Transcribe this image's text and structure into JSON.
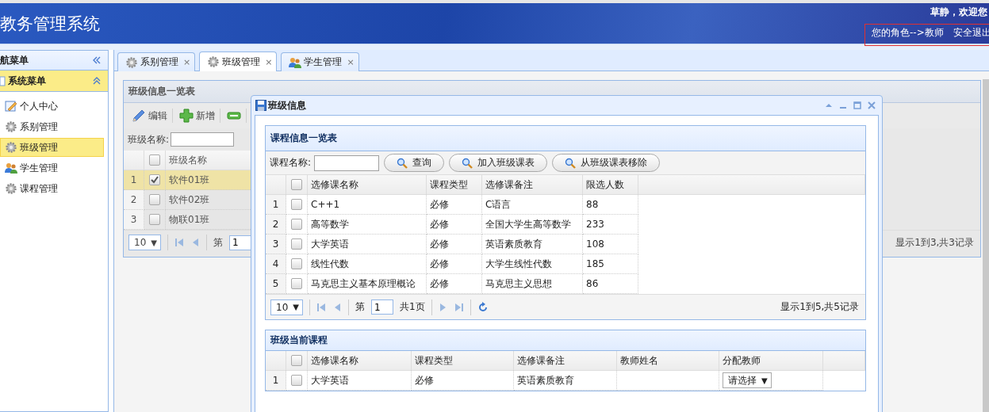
{
  "header": {
    "title": "教务管理系统",
    "welcome": "草静，欢迎您",
    "role": "您的角色-->教师",
    "logout": "安全退出"
  },
  "sidebar": {
    "title": "航菜单",
    "group": {
      "title": "系统菜单",
      "expanded": true
    },
    "items": [
      {
        "label": "个人中心",
        "kind": "profile",
        "selected": false
      },
      {
        "label": "系别管理",
        "kind": "gear",
        "selected": false
      },
      {
        "label": "班级管理",
        "kind": "gear",
        "selected": true
      },
      {
        "label": "学生管理",
        "kind": "users",
        "selected": false
      },
      {
        "label": "课程管理",
        "kind": "gear",
        "selected": false
      }
    ]
  },
  "tabs": [
    {
      "label": "系别管理",
      "kind": "gear",
      "selected": false,
      "close": "×"
    },
    {
      "label": "班级管理",
      "kind": "gear",
      "selected": true,
      "close": "×"
    },
    {
      "label": "学生管理",
      "kind": "users",
      "selected": false,
      "close": "×"
    }
  ],
  "class_panel": {
    "title": "班级信息一览表",
    "toolbar": [
      {
        "label": "编辑",
        "kind": "pencil"
      },
      {
        "label": "新增",
        "kind": "plus"
      },
      {
        "kind": "minus"
      }
    ],
    "search_label": "班级名称:",
    "header_checked": false,
    "columns": [
      "班级名称"
    ],
    "rows": [
      {
        "num": "1",
        "name": "软件01班",
        "checked": true,
        "selected": true
      },
      {
        "num": "2",
        "name": "软件02班",
        "checked": false,
        "selected": false
      },
      {
        "num": "3",
        "name": "物联01班",
        "checked": false,
        "selected": false
      }
    ],
    "pager": {
      "page_size": "10",
      "arrow": "▼",
      "page_label": "第",
      "page_value": "1",
      "summary": "显示1到3,共3记录"
    }
  },
  "dialog": {
    "title": "班级信息",
    "course_panel": {
      "title": "课程信息一览表",
      "search_label": "课程名称:",
      "buttons": [
        "查询",
        "加入班级课表",
        "从班级课表移除"
      ],
      "header_checked": false,
      "columns": [
        "选修课名称",
        "课程类型",
        "选修课备注",
        "限选人数"
      ],
      "rows": [
        {
          "num": "1",
          "checked": false,
          "cells": [
            "C++1",
            "必修",
            "C语言",
            "88"
          ]
        },
        {
          "num": "2",
          "checked": false,
          "cells": [
            "高等数学",
            "必修",
            "全国大学生高等数学",
            "233"
          ]
        },
        {
          "num": "3",
          "checked": false,
          "cells": [
            "大学英语",
            "必修",
            "英语素质教育",
            "108"
          ]
        },
        {
          "num": "4",
          "checked": false,
          "cells": [
            "线性代数",
            "必修",
            "大学生线性代数",
            "185"
          ]
        },
        {
          "num": "5",
          "checked": false,
          "cells": [
            "马克思主义基本原理概论",
            "必修",
            "马克思主义思想",
            "86"
          ]
        }
      ],
      "pager": {
        "page_size": "10",
        "arrow": "▼",
        "page_label": "第",
        "page_value": "1",
        "total": "共1页",
        "summary": "显示1到5,共5记录"
      }
    },
    "current_panel": {
      "title": "班级当前课程",
      "header_checked": false,
      "columns": [
        "选修课名称",
        "课程类型",
        "选修课备注",
        "教师姓名",
        "分配教师"
      ],
      "rows": [
        {
          "num": "1",
          "checked": false,
          "name": "大学英语",
          "type": "必修",
          "remark": "英语素质教育",
          "assign": "请选择",
          "arrow": "▼"
        }
      ]
    }
  }
}
